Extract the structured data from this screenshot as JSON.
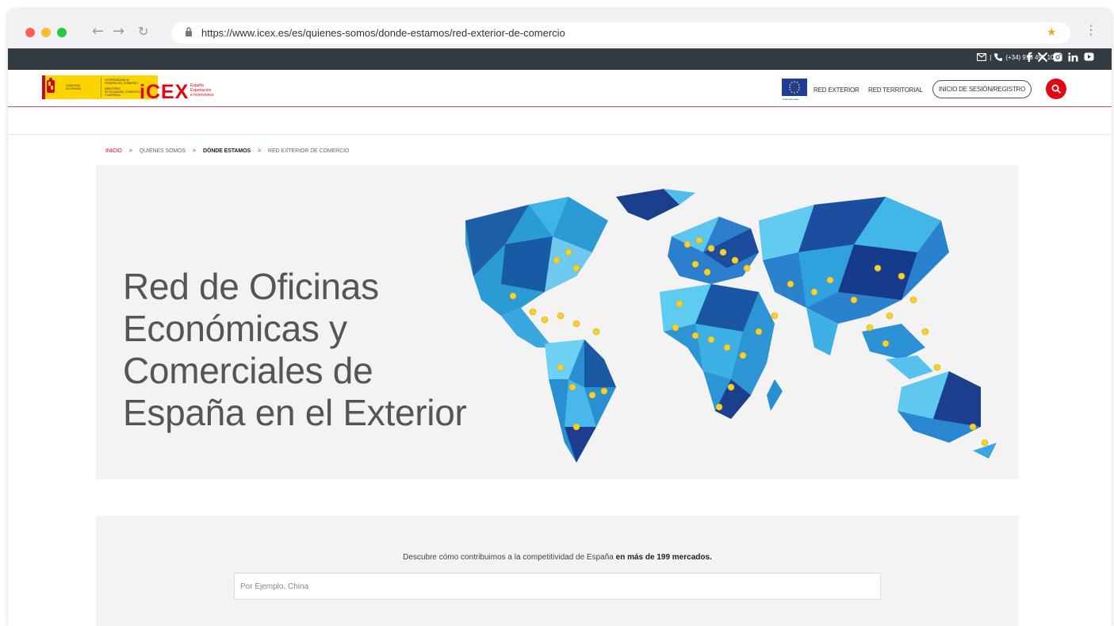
{
  "browser": {
    "url": "https://www.icex.es/es/quienes-somos/donde-estamos/red-exterior-de-comercio",
    "traffic_colors": [
      "#ff5f57",
      "#febc2e",
      "#28c840"
    ]
  },
  "topbar": {
    "phone": "(+34) 913 497 100",
    "separator": "|"
  },
  "header": {
    "gov_lines_left": [
      "GOBIERNO",
      "DE ESPAÑA"
    ],
    "gov_lines_right": [
      "VICEPRESIDENCIA",
      "PRIMERA DEL GOBIERNO",
      "MINISTERIO",
      "DE ECONOMÍA, COMERCIO",
      "Y EMPRESA"
    ],
    "icex_logo": "iCEX",
    "icex_sub": [
      "España",
      "Exportación",
      "e Inversiones"
    ],
    "eu_caption": "Unión Europea",
    "nav": [
      "RED EXTERIOR",
      "RED TERRITORIAL"
    ],
    "login_label": "INICIO DE SESIÓN/REGISTRO",
    "brand_color": "#e30613"
  },
  "breadcrumb": {
    "items": [
      "INICIO",
      "QUIÉNES SOMOS",
      "DÓNDE ESTAMOS",
      "RED EXTERIOR DE COMERCIO"
    ],
    "separator": ">"
  },
  "hero": {
    "title_lines": [
      "Red de Oficinas",
      "Económicas y",
      "Comerciales de",
      "España en el Exterior"
    ]
  },
  "search": {
    "intro_text": "Descubre cómo contribuimos a la competitividad de España",
    "intro_bold": "en más de 199 mercados.",
    "placeholder": "Por Ejemplo, China"
  }
}
